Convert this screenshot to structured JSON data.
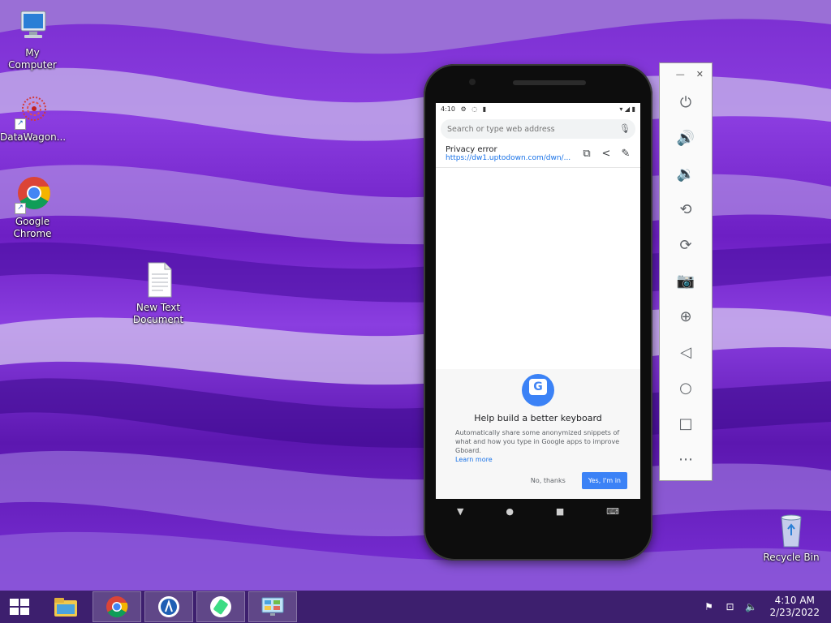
{
  "desktop": {
    "icons": [
      {
        "label": "My Computer",
        "icon": "computer-icon"
      },
      {
        "label": "DataWagon...",
        "icon": "datawagon-icon"
      },
      {
        "label": "Google Chrome",
        "icon": "chrome-icon"
      },
      {
        "label": "New Text Document",
        "icon": "text-document-icon"
      },
      {
        "label": "Recycle Bin",
        "icon": "recycle-bin-icon"
      }
    ]
  },
  "phone": {
    "status": {
      "time": "4:10"
    },
    "url_bar": {
      "placeholder": "Search or type web address"
    },
    "suggestion": {
      "title": "Privacy error",
      "url": "https://dw1.uptodown.com/dwn/..."
    },
    "gboard_prompt": {
      "title": "Help build a better keyboard",
      "body": "Automatically share some anonymized snippets of what and how you type in Google apps to improve Gboard.",
      "link": "Learn more",
      "decline": "No, thanks",
      "accept": "Yes, I'm in"
    }
  },
  "emulator_panel": {
    "tools": [
      "power-icon",
      "volume-up-icon",
      "volume-down-icon",
      "rotate-left-icon",
      "rotate-right-icon",
      "camera-icon",
      "zoom-icon",
      "back-icon",
      "home-icon",
      "overview-icon",
      "more-icon"
    ]
  },
  "taskbar": {
    "clock": {
      "time": "4:10 AM",
      "date": "2/23/2022"
    }
  },
  "colors": {
    "accent": "#3b82f6",
    "taskbar": "#3d1f6e",
    "wallpaper": "#7a2ed0"
  }
}
